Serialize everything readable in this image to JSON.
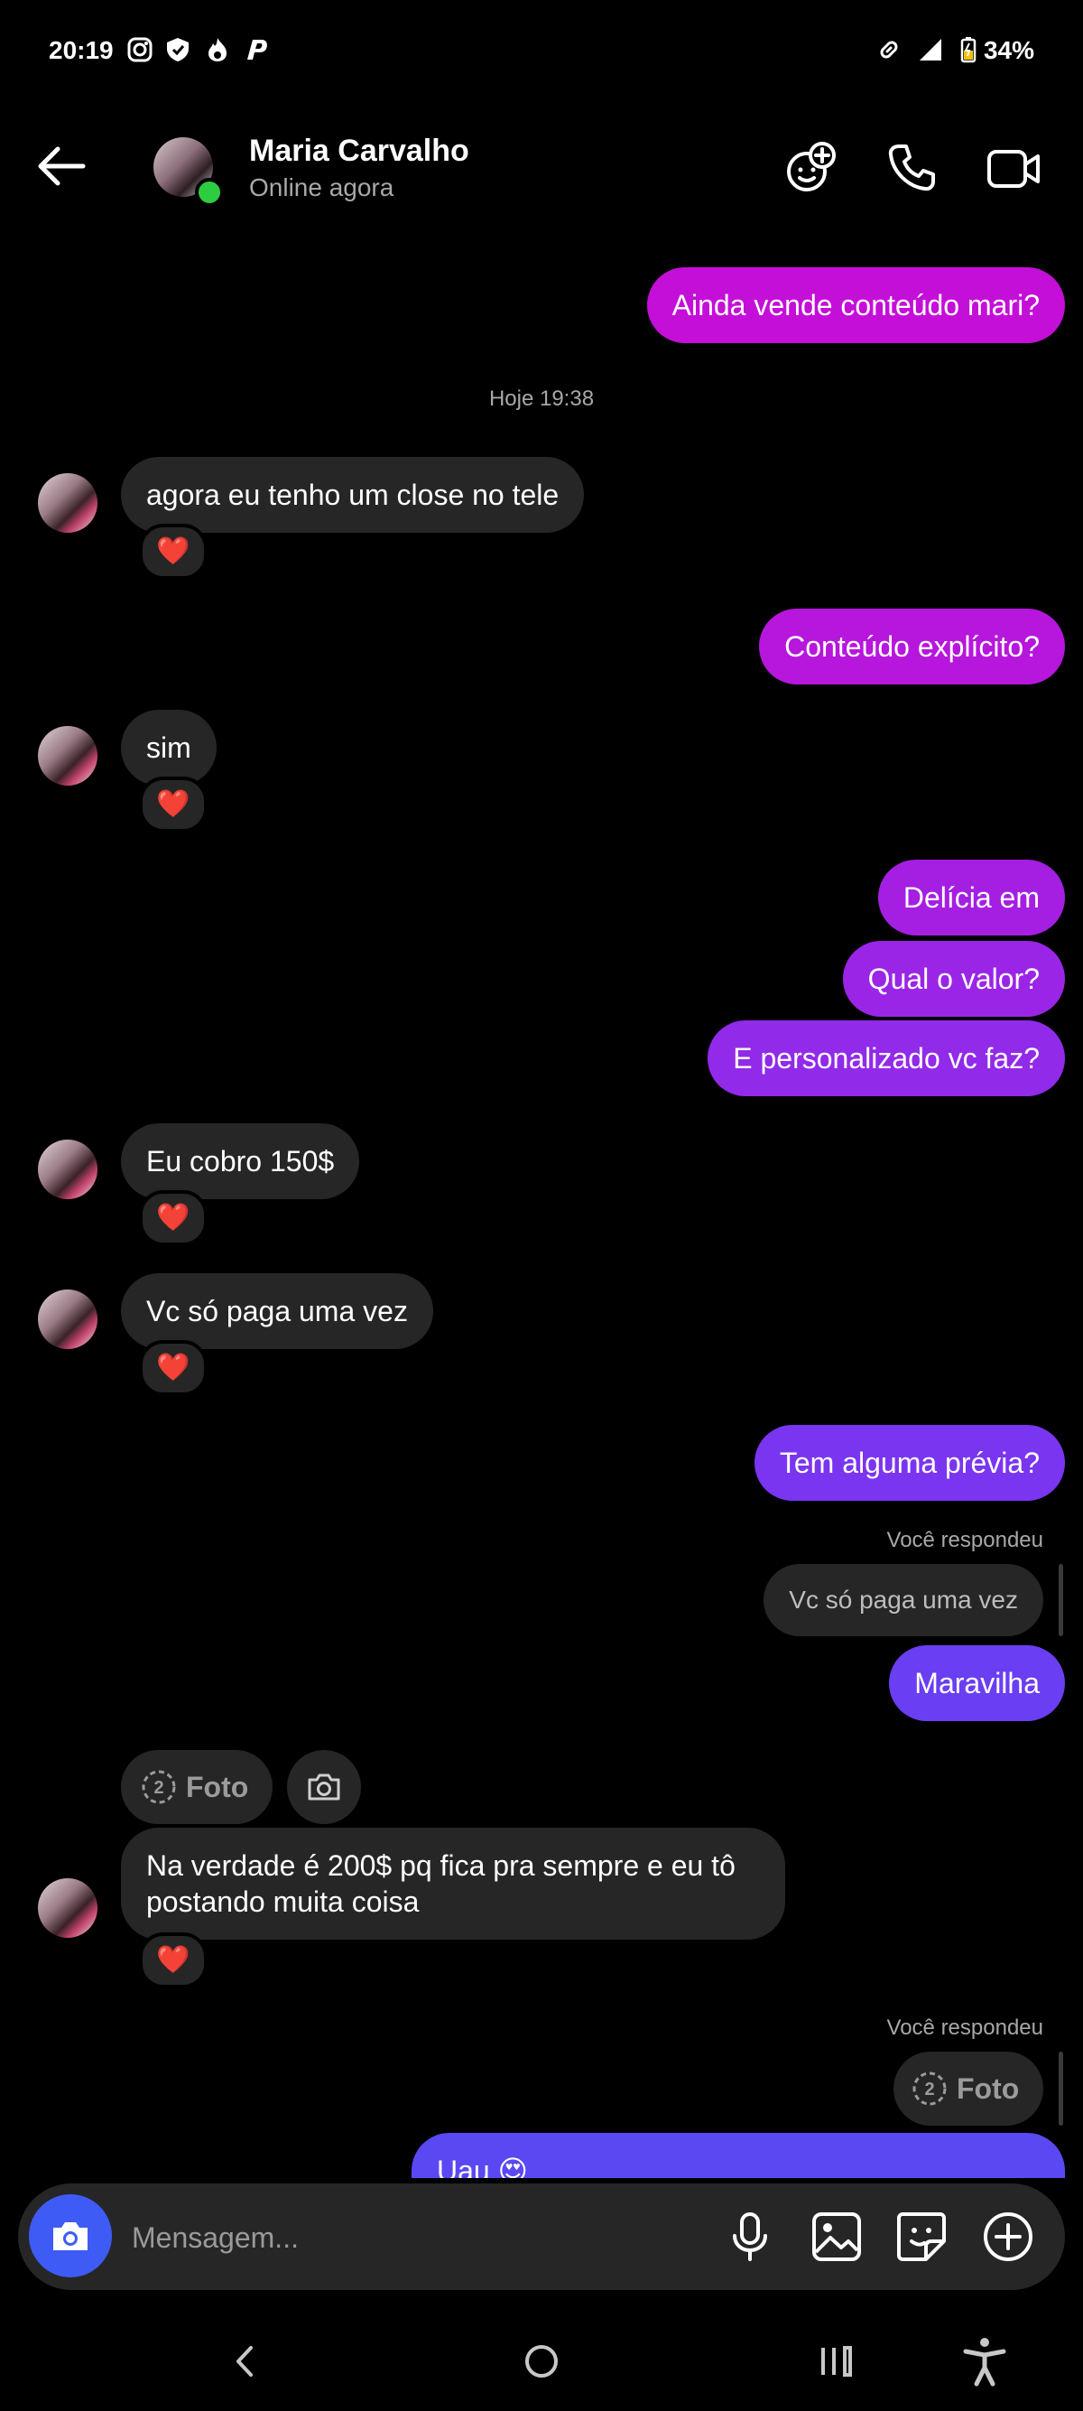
{
  "status_bar": {
    "time": "20:19",
    "battery": "34%",
    "icons": [
      "instagram-icon",
      "shield-icon",
      "flame-icon",
      "p-app-icon",
      "link-icon",
      "signal-icon",
      "battery-icon"
    ]
  },
  "header": {
    "name": "Maria Carvalho",
    "status": "Online agora",
    "icons": [
      "back-arrow-icon",
      "add-effects-icon",
      "phone-icon",
      "video-icon"
    ]
  },
  "conversation": {
    "msg1": "Ainda vende conteúdo mari?",
    "timestamp": "Hoje 19:38",
    "msg2": "agora eu tenho um close no tele",
    "msg3": "Conteúdo explícito?",
    "msg4": "sim",
    "msg5": "Delícia em",
    "msg6": "Qual o valor?",
    "msg7": "E personalizado vc faz?",
    "msg8": "Eu cobro 150$",
    "msg9": "Vc só paga uma vez",
    "msg10": "Tem alguma prévia?",
    "replied_label_1": "Você respondeu",
    "quote_1": "Vc só paga uma vez",
    "msg11": "Maravilha",
    "photo_chip": "Foto",
    "photo_chip_count": "2",
    "msg12_line1": "Na verdade é 200$ pq fica pra sempre e eu tô",
    "msg12_line2": "postando muita coisa",
    "replied_label_2": "Você respondeu",
    "quote_2": "Foto",
    "quote_2_count": "2",
    "msg13": "Uau 😍",
    "reaction": "❤️"
  },
  "colors": {
    "out_pink": "#c40fd8",
    "out_purple": "#9b25e6",
    "out_violet": "#7a35f0",
    "out_blue": "#5a48f2",
    "incoming": "#262626",
    "accent_camera": "#3f5bf5"
  },
  "composer": {
    "placeholder": "Mensagem...",
    "icons": [
      "camera-icon",
      "microphone-icon",
      "gallery-icon",
      "sticker-icon",
      "plus-icon"
    ]
  },
  "nav_bar": {
    "icons": [
      "nav-back-icon",
      "nav-home-icon",
      "nav-recents-icon",
      "accessibility-icon"
    ]
  }
}
